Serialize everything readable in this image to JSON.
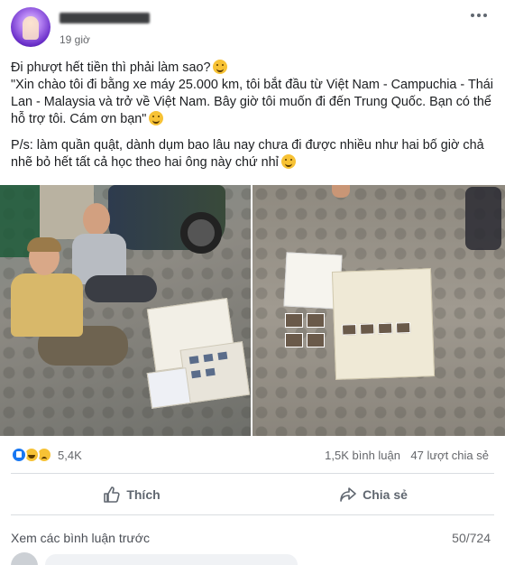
{
  "post": {
    "author_name": "",
    "time": "19 giờ",
    "text": {
      "line1": "Đi phượt hết tiền thì phải làm sao?",
      "quote": "\"Xin chào tôi đi bằng xe máy 25.000 km, tôi bắt đầu từ Việt Nam - Campuchia - Thái Lan - Malaysia và trở về Việt Nam. Bây giờ tôi muốn đi đến Trung Quốc. Bạn có thể hỗ trợ tôi. Cám ơn bạn\"",
      "ps": "P/s: làm quần quật, dành dụm bao lâu nay chưa đi được nhiều như hai bố giờ chả nhẽ bỏ hết tất cả học theo hai ông này chứ nhỉ"
    },
    "icons": {
      "avatar": "profile-avatar",
      "more": "more-options-icon",
      "emoji1": "dizzy-face-emoji",
      "emoji2": "upside-down-face-emoji",
      "emoji3": "thinking-face-emoji"
    }
  },
  "stats": {
    "reaction_count": "5,4K",
    "comments": "1,5K bình luận",
    "shares": "47 lượt chia sẻ",
    "reaction_icons": [
      "like-reaction-icon",
      "haha-reaction-icon",
      "sad-reaction-icon"
    ]
  },
  "actions": {
    "like_label": "Thích",
    "share_label": "Chia sẻ"
  },
  "comments": {
    "view_previous": "Xem các bình luận trước",
    "page": "50/724"
  },
  "colors": {
    "text": "#1c1e21",
    "secondary": "#65676b",
    "like_blue": "#1877f2",
    "divider": "#dadde1"
  }
}
